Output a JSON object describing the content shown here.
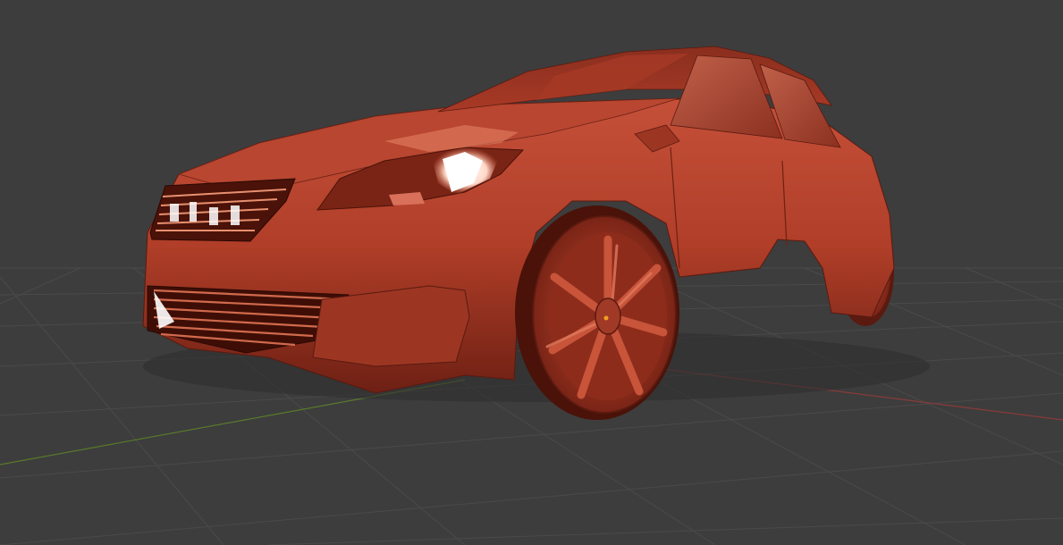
{
  "viewport": {
    "background_color": "#3d3d3d",
    "grid_color": "#4a4a4a",
    "x_axis_color": "#8a3a3a",
    "y_axis_color": "#5a7a2a"
  },
  "model": {
    "subject": "hatchback car",
    "body_color": "#b8412a",
    "shadow_color": "#5a1a10",
    "highlight_color": "#ffffff"
  },
  "origin_marker": {
    "color": "#f0a020"
  }
}
